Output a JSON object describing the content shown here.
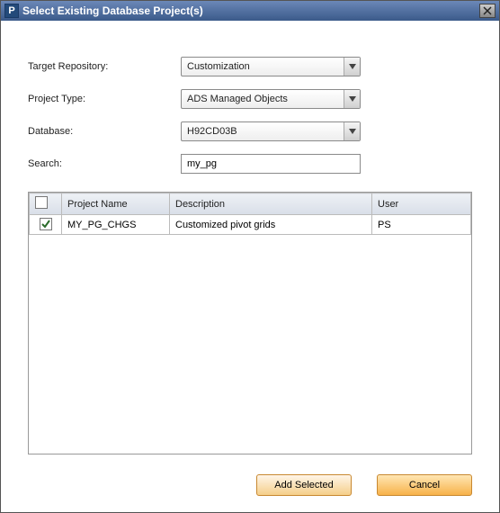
{
  "window": {
    "title": "Select Existing Database Project(s)",
    "icon_letter": "P"
  },
  "form": {
    "repo_label": "Target Repository:",
    "repo_value": "Customization",
    "type_label": "Project Type:",
    "type_value": "ADS Managed Objects",
    "db_label": "Database:",
    "db_value": "H92CD03B",
    "search_label": "Search:",
    "search_value": "my_pg"
  },
  "table": {
    "headers": {
      "name": "Project Name",
      "desc": "Description",
      "user": "User"
    },
    "rows": [
      {
        "checked": true,
        "name": "MY_PG_CHGS",
        "desc": "Customized pivot grids",
        "user": "PS"
      }
    ]
  },
  "buttons": {
    "add": "Add Selected",
    "cancel": "Cancel"
  }
}
